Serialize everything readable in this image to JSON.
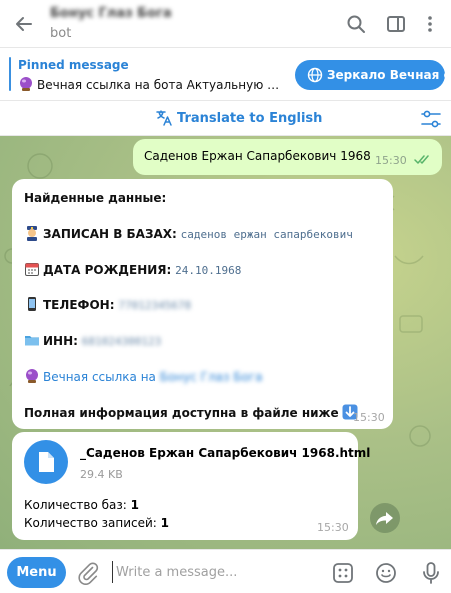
{
  "header": {
    "chat_title": "Бонус Глаз Бога",
    "subtitle": "bot"
  },
  "pinned": {
    "title": "Pinned message",
    "text": "Вечная ссылка на бота  Актуальную ссылку на бота всегда можно найти здесь",
    "mirror_button": "Зеркало Вечная ссылка"
  },
  "translate": {
    "label": "Translate to English"
  },
  "messages": {
    "outgoing": {
      "text": "Саденов Ержан Сапарбекович 1968",
      "time": "15:30"
    },
    "result": {
      "heading": "Найденные данные:",
      "bases_label": "ЗАПИСАН В БАЗАХ:",
      "bases_value": "саденов ержан сапарбекович",
      "dob_label": "ДАТА РОЖДЕНИЯ:",
      "dob_value": "24.10.1968",
      "phone_label": "ТЕЛЕФОН:",
      "phone_value": "77012345678",
      "inn_label": "ИНН:",
      "inn_value": "681024300123",
      "link_text": "Вечная ссылка на",
      "link_hidden": "Бонус Глаз Бога",
      "footer": "Полная информация доступна в файле ниже",
      "time": "15:30"
    },
    "file": {
      "name": "_Саденов Ержан Сапарбекович 1968.html",
      "size": "29.4 KB",
      "bases_label": "Количество баз:",
      "bases_count": "1",
      "records_label": "Количество записей:",
      "records_count": "1",
      "time": "15:30"
    }
  },
  "composer": {
    "menu_label": "Menu",
    "placeholder": "Write a message..."
  },
  "colors": {
    "accent": "#3390e6",
    "outgoing_bubble": "#e1fec6",
    "link": "#2b83d6"
  },
  "icons": [
    "back-arrow-icon",
    "search-icon",
    "sidebar-toggle-icon",
    "more-vert-icon",
    "globe-icon",
    "translate-icon",
    "translate-settings-icon",
    "read-checks-icon",
    "police-officer-emoji",
    "calendar-emoji",
    "phone-emoji",
    "folder-emoji",
    "crystal-ball-emoji",
    "down-arrow-emoji",
    "file-icon",
    "forward-icon",
    "attach-icon",
    "bot-commands-icon",
    "emoji-icon",
    "microphone-icon"
  ]
}
